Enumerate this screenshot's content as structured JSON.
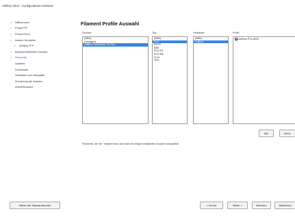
{
  "window": {
    "title": "Artillery Slicer - Konfigurations-Assistent"
  },
  "sidebar": {
    "items": [
      {
        "label": "Willkommen",
        "indent": false,
        "active": false
      },
      {
        "label": "Prusa FFF",
        "indent": false,
        "active": false
      },
      {
        "label": "Prusa MSLA",
        "indent": false,
        "active": false
      },
      {
        "label": "Andere Hersteller",
        "indent": false,
        "active": false
      },
      {
        "label": "Artillery FFF",
        "indent": true,
        "active": false
      },
      {
        "label": "Benutzerdefinierter Drucker",
        "indent": false,
        "active": false
      },
      {
        "label": "Filamente",
        "indent": false,
        "active": true
      },
      {
        "label": "Updates",
        "indent": false,
        "active": false
      },
      {
        "label": "Downloads",
        "indent": false,
        "active": false
      },
      {
        "label": "Herstellen von Heizplatte",
        "indent": false,
        "active": false
      },
      {
        "label": "Zuordnung der Dateien",
        "indent": false,
        "active": false
      },
      {
        "label": "Ansichtsmodus",
        "indent": false,
        "active": false
      }
    ]
  },
  "main": {
    "title": "Filament Profile Auswahl",
    "columns": {
      "drucker": {
        "label": "Drucker:",
        "items": [
          {
            "text": "(Alles)",
            "selected": false
          },
          {
            "text": "(Vorlagen)",
            "selected": false
          },
          {
            "text": "Artillery Sidewinder X4 Plus",
            "selected": true
          }
        ]
      },
      "typ": {
        "label": "Typ:",
        "items": [
          {
            "text": "(Alles)",
            "selected": false
          },
          {
            "text": "PLA",
            "selected": true
          },
          {
            "text": "PETG",
            "selected": false
          },
          {
            "text": "ABS",
            "selected": false
          },
          {
            "text": "PLA HS",
            "selected": false
          },
          {
            "text": "PLA Silk",
            "selected": false
          },
          {
            "text": "PLA+",
            "selected": false
          },
          {
            "text": "TPU",
            "selected": false
          }
        ]
      },
      "hersteller": {
        "label": "Hersteller:",
        "items": [
          {
            "text": "(Alles)",
            "selected": false
          },
          {
            "text": "Artillery",
            "selected": true
          }
        ]
      },
      "profil": {
        "label": "Profil:",
        "items": [
          {
            "text": "Artillery PLA @X4",
            "checked": true
          }
        ]
      }
    },
    "buttons": {
      "alle": "Alle",
      "keine": "Keine"
    },
    "notice": "Filamente, die mit * markiert sind, sind nicht mit einigen installierten Druckern kompatibel."
  },
  "footer": {
    "standard_drucker": "Wähle alle Standarddrucker",
    "zurueck": "< Zurück",
    "weiter": "Weiter >",
    "beenden": "Beenden",
    "abbrechen": "Abbrechen"
  },
  "colors": {
    "selection": "#3a84e0",
    "active_sidebar": "#1e6fd0"
  }
}
